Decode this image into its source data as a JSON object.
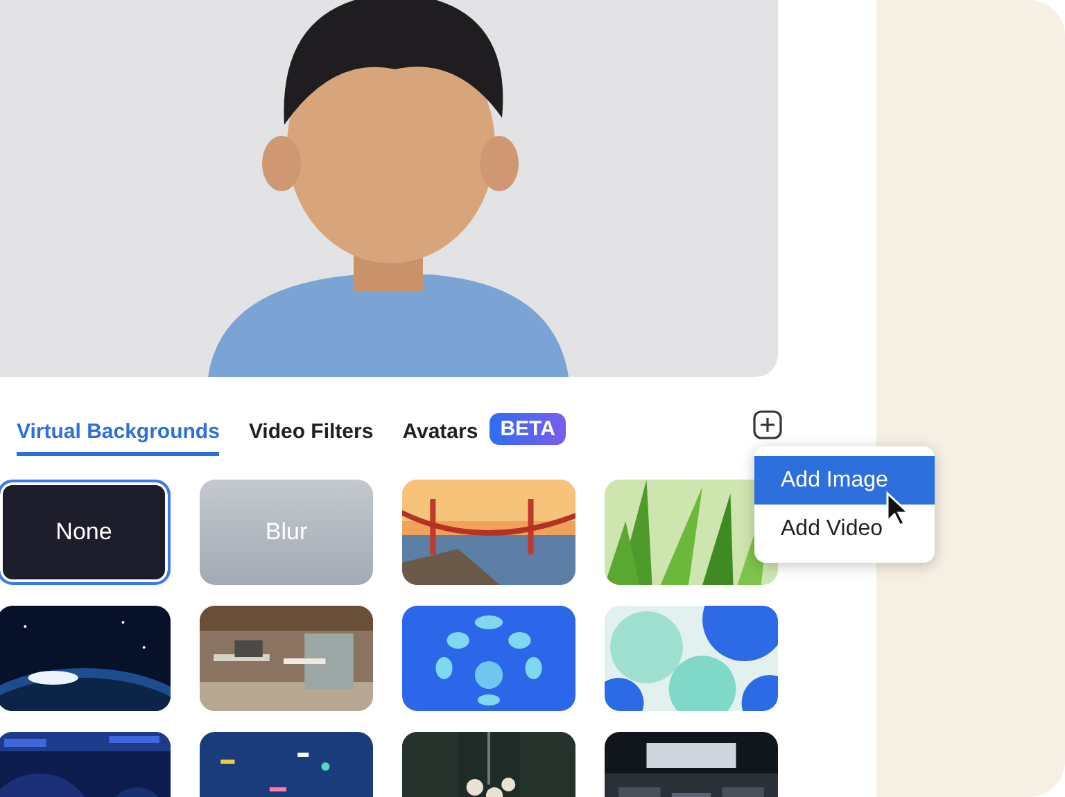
{
  "preview": {
    "kind": "picture"
  },
  "tabs": [
    {
      "label": "Virtual Backgrounds",
      "selected": true
    },
    {
      "label": "Video Filters",
      "selected": false
    },
    {
      "label": "Avatars",
      "selected": false,
      "badge": "BETA"
    }
  ],
  "menu": {
    "items": [
      {
        "label": "Add Image",
        "selected": true
      },
      {
        "label": "Add Video",
        "selected": false
      }
    ]
  },
  "backgrounds": [
    {
      "kind": "none",
      "label": "None",
      "selected": true
    },
    {
      "kind": "blur",
      "label": "Blur",
      "selected": false
    },
    {
      "kind": "picture",
      "selected": false
    },
    {
      "kind": "picture",
      "selected": false
    },
    {
      "kind": "picture",
      "selected": false
    },
    {
      "kind": "picture",
      "selected": false
    },
    {
      "kind": "picture",
      "selected": false
    },
    {
      "kind": "picture",
      "selected": false
    },
    {
      "kind": "picture",
      "selected": false
    },
    {
      "kind": "picture",
      "selected": false
    },
    {
      "kind": "picture",
      "selected": false
    },
    {
      "kind": "picture",
      "selected": false
    }
  ]
}
